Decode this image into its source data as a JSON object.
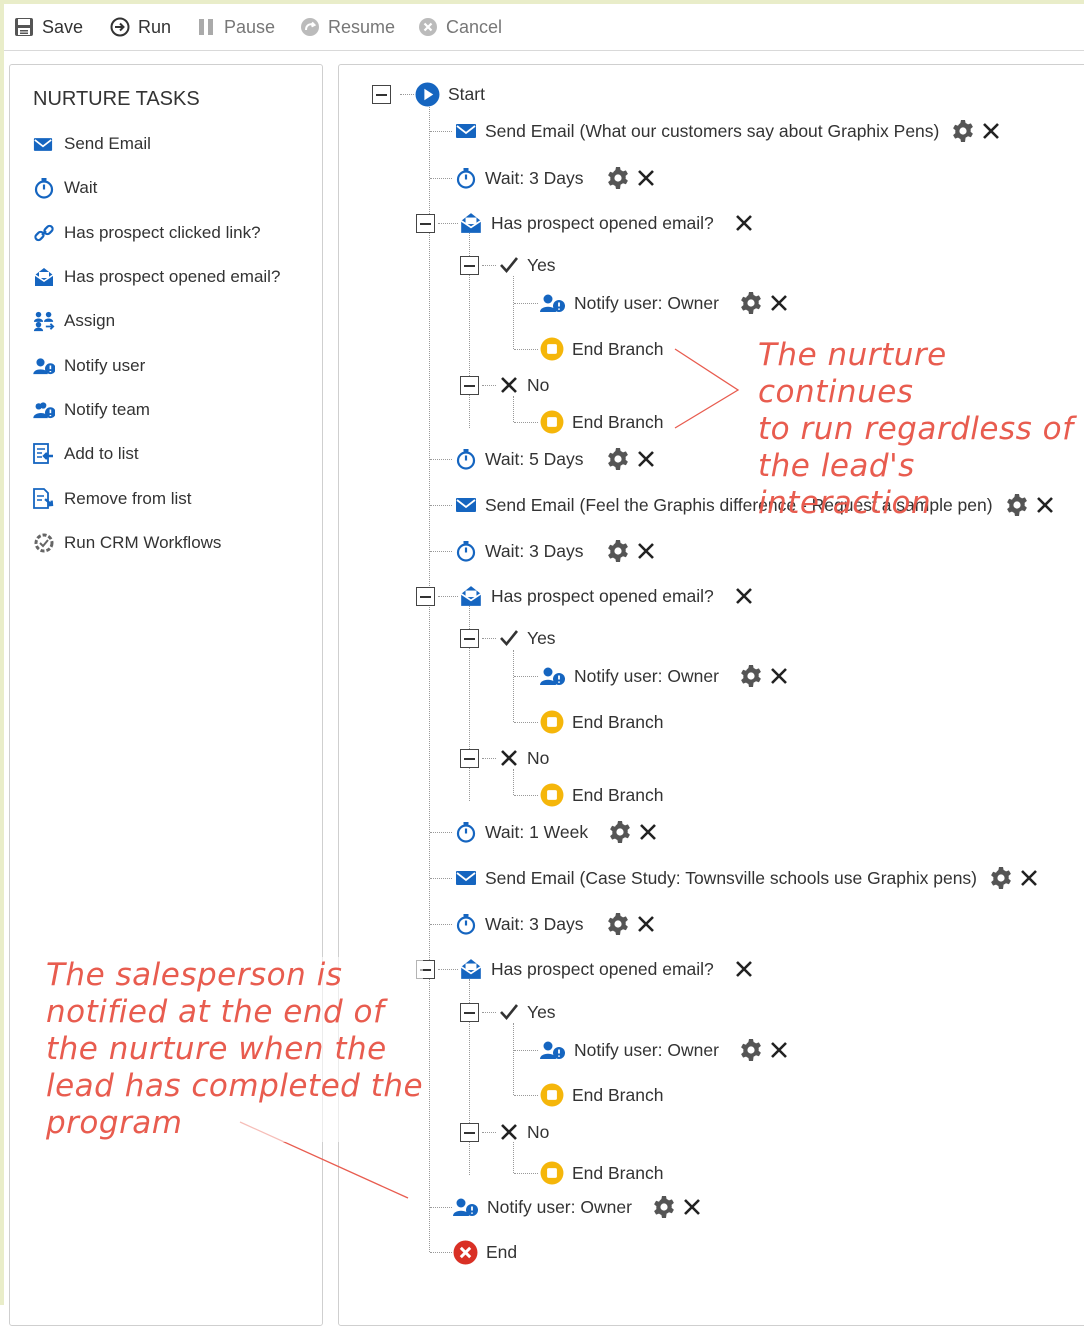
{
  "toolbar": {
    "save": "Save",
    "run": "Run",
    "pause": "Pause",
    "resume": "Resume",
    "cancel": "Cancel"
  },
  "left_panel": {
    "title": "NURTURE TASKS",
    "items": [
      {
        "label": "Send Email",
        "icon": "envelope-icon"
      },
      {
        "label": "Wait",
        "icon": "stopwatch-icon"
      },
      {
        "label": "Has prospect clicked link?",
        "icon": "link-icon"
      },
      {
        "label": "Has prospect opened email?",
        "icon": "open-envelope-icon"
      },
      {
        "label": "Assign",
        "icon": "assign-users-icon"
      },
      {
        "label": "Notify user",
        "icon": "notify-user-icon"
      },
      {
        "label": "Notify team",
        "icon": "notify-team-icon"
      },
      {
        "label": "Add to list",
        "icon": "add-to-list-icon"
      },
      {
        "label": "Remove from list",
        "icon": "remove-from-list-icon"
      },
      {
        "label": "Run CRM Workflows",
        "icon": "crm-workflow-icon"
      }
    ]
  },
  "tree": {
    "start": "Start",
    "send_email_1": {
      "label": "Send Email",
      "detail": "(What our customers say about Graphix Pens)"
    },
    "wait_1": "Wait: 3 Days",
    "opened_1": "Has prospect opened email?",
    "yes_1": "Yes",
    "notify_1": "Notify user: Owner",
    "end_branch_1a": "End Branch",
    "no_1": "No",
    "end_branch_1b": "End Branch",
    "wait_2": "Wait: 5 Days",
    "send_email_2": {
      "label": "Send Email",
      "detail": "(Feel the Graphis difference - Request a sample pen)"
    },
    "wait_3": "Wait: 3 Days",
    "opened_2": "Has prospect opened email?",
    "yes_2": "Yes",
    "notify_2": "Notify user: Owner",
    "end_branch_2a": "End Branch",
    "no_2": "No",
    "end_branch_2b": "End Branch",
    "wait_4": "Wait: 1 Week",
    "send_email_3": {
      "label": "Send Email",
      "detail": "(Case Study: Townsville schools use Graphix pens)"
    },
    "wait_5": "Wait: 3 Days",
    "opened_3": "Has prospect opened email?",
    "yes_3": "Yes",
    "notify_3": "Notify user: Owner",
    "end_branch_3a": "End Branch",
    "no_3": "No",
    "end_branch_3b": "End Branch",
    "notify_final": "Notify user: Owner",
    "end": "End"
  },
  "annotations": {
    "right_1": "The nurture continues",
    "right_2": "to run regardless of",
    "right_3": "the lead's interaction",
    "left_1": "The salesperson is",
    "left_2": "notified at the end of",
    "left_3": "the nurture when the",
    "left_4": "lead has completed the",
    "left_5": "program"
  },
  "colors": {
    "accent_blue": "#1565c0",
    "end_branch_yellow": "#f5b60a",
    "end_red": "#d93025",
    "annotation_red": "#e85c4f",
    "frame_green": "#e9edc9"
  }
}
